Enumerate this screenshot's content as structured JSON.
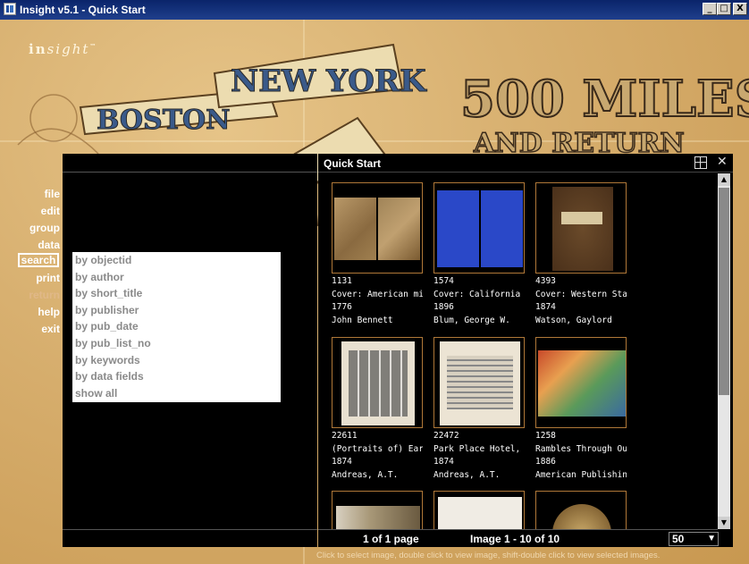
{
  "window": {
    "title": "Insight v5.1 - Quick Start",
    "buttons": [
      "_",
      "□",
      "X"
    ]
  },
  "logo": {
    "prefix": "in",
    "suffix": "sight",
    "tm": "™"
  },
  "poster_text": [
    "BOSTON",
    "NEW YORK",
    "500 MILES",
    "AND RETURN"
  ],
  "menu": {
    "items": [
      {
        "label": "file",
        "dim": false
      },
      {
        "label": "edit",
        "dim": false
      },
      {
        "label": "group",
        "dim": false
      },
      {
        "label": "data",
        "dim": false
      },
      {
        "label": "search",
        "dim": false,
        "selected": true
      },
      {
        "label": "print",
        "dim": false
      },
      {
        "label": "return",
        "dim": true
      },
      {
        "label": "help",
        "dim": false
      },
      {
        "label": "exit",
        "dim": false
      }
    ]
  },
  "search_submenu": [
    "by objectid",
    "by author",
    "by short_title",
    "by publisher",
    "by pub_date",
    "by pub_list_no",
    "by keywords",
    "by data fields",
    "show all"
  ],
  "panel": {
    "title": "Quick Start",
    "grid_icon": "grid-view-icon",
    "close_icon": "close-icon",
    "footer": {
      "page_info": "1 of 1 page",
      "image_info": "Image 1 - 10 of 10",
      "per_page": "50"
    }
  },
  "thumbnails": [
    {
      "id": "1131",
      "title": "Cover: American mi",
      "year": "1776",
      "author": "John Bennett",
      "style": "book-tan"
    },
    {
      "id": "1574",
      "title": "Cover: California cy",
      "year": "1896",
      "author": "Blum, George W.",
      "style": "book-blue"
    },
    {
      "id": "4393",
      "title": "Cover: Western Stat",
      "year": "1874",
      "author": "Watson, Gaylord",
      "style": "book-brown"
    },
    {
      "id": "22611",
      "title": "(Portraits of) Early s",
      "year": "1874",
      "author": "Andreas, A.T.",
      "style": "portraits"
    },
    {
      "id": "22472",
      "title": "Park Place Hotel, Gr",
      "year": "1874",
      "author": "Andreas, A.T.",
      "style": "building"
    },
    {
      "id": "1258",
      "title": "Rambles Through Ou",
      "year": "1886",
      "author": "American Publishing",
      "style": "map"
    },
    {
      "id": "",
      "title": "",
      "year": "",
      "author": "",
      "style": "partial1"
    },
    {
      "id": "",
      "title": "",
      "year": "",
      "author": "",
      "style": "partial2"
    },
    {
      "id": "",
      "title": "",
      "year": "",
      "author": "",
      "style": "partial3"
    }
  ],
  "hint": "Click to select image, double click to view image, shift-double click to view selected images."
}
